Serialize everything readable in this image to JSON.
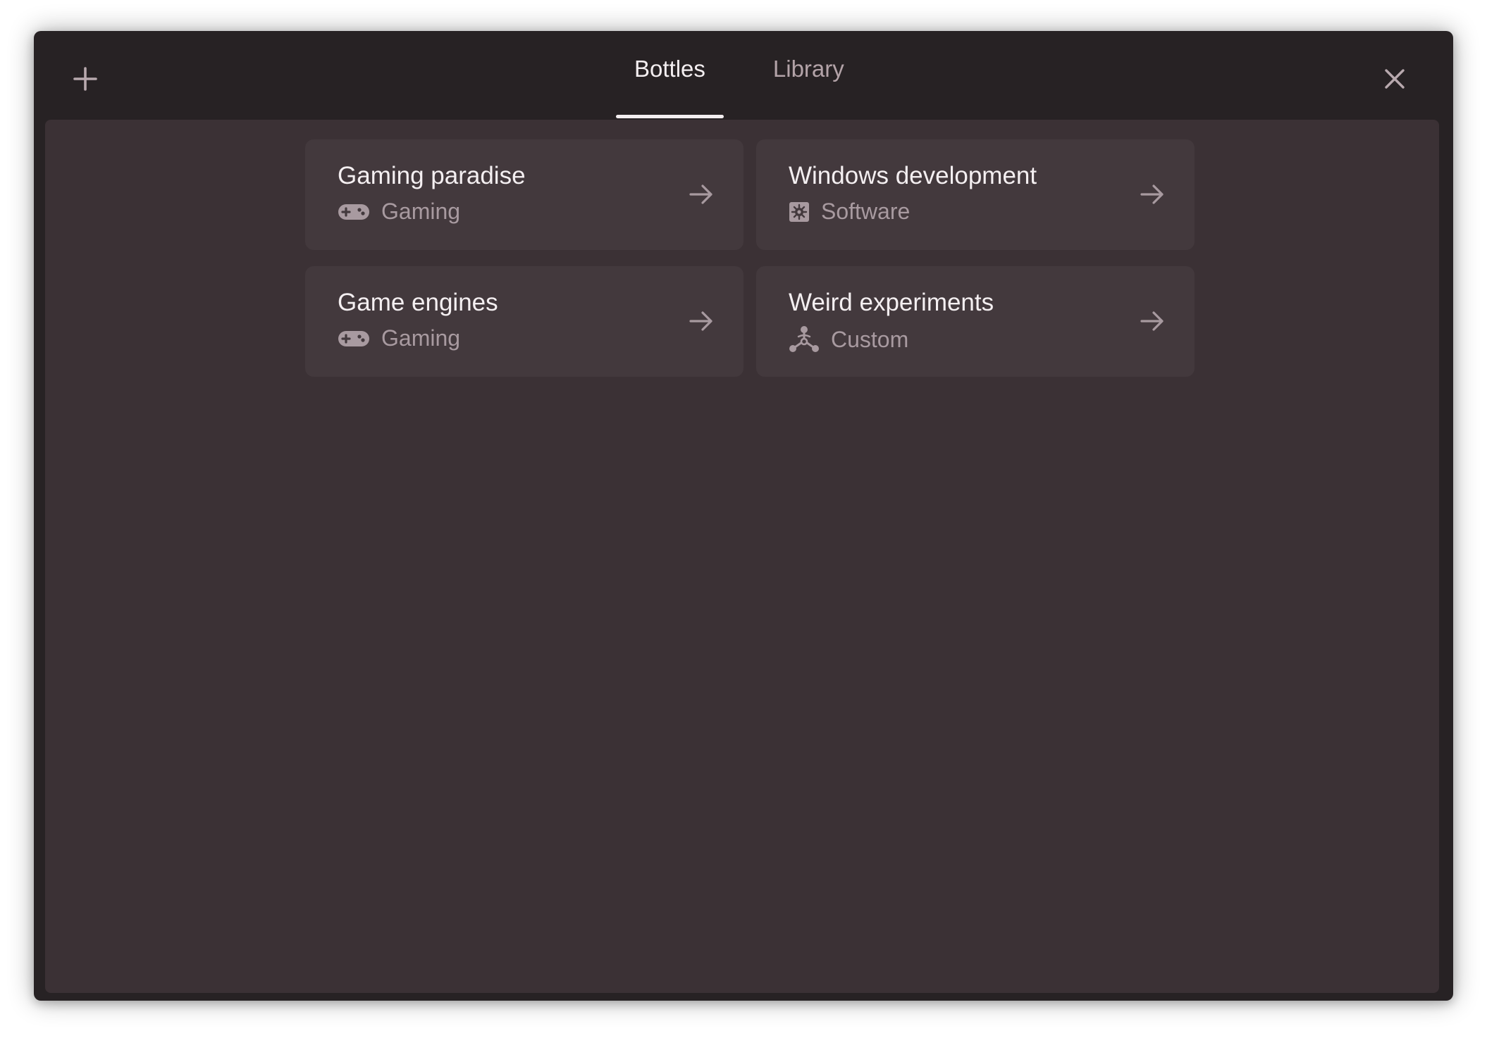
{
  "header": {
    "add_icon": "plus-icon",
    "close_icon": "close-icon",
    "tabs": [
      {
        "label": "Bottles",
        "active": true
      },
      {
        "label": "Library",
        "active": false
      }
    ]
  },
  "bottles": [
    {
      "name": "Gaming paradise",
      "environment": "Gaming",
      "icon": "gamepad-icon"
    },
    {
      "name": "Windows development",
      "environment": "Software",
      "icon": "software-icon"
    },
    {
      "name": "Game engines",
      "environment": "Gaming",
      "icon": "gamepad-icon"
    },
    {
      "name": "Weird experiments",
      "environment": "Custom",
      "icon": "custom-icon"
    }
  ],
  "colors": {
    "window_bg": "#272224",
    "content_bg": "#3b3135",
    "card_bg": "#43393d",
    "text_primary": "#f4eff1",
    "text_secondary": "#a89aa0"
  }
}
